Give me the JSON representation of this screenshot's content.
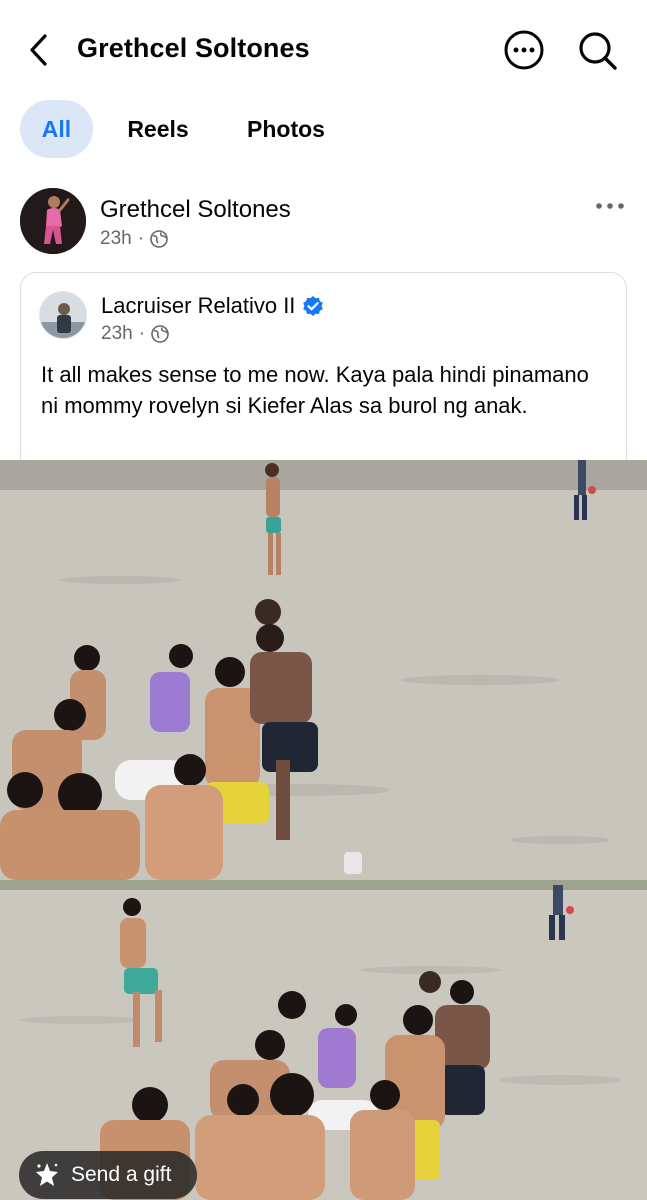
{
  "header": {
    "title": "Grethcel Soltones",
    "icons": {
      "back": "chevron-left-icon",
      "more": "more-circle-icon",
      "search": "search-icon"
    }
  },
  "tabs": [
    {
      "label": "All",
      "active": true
    },
    {
      "label": "Reels",
      "active": false
    },
    {
      "label": "Photos",
      "active": false
    }
  ],
  "post": {
    "author": "Grethcel Soltones",
    "time": "23h",
    "separator": "·",
    "audience_icon": "globe-icon",
    "more_icon": "horizontal-dots-icon",
    "shared": {
      "author": "Lacruiser Relativo II",
      "verified": true,
      "time": "23h",
      "separator": "·",
      "text": "It all makes sense to me now. Kaya pala hindi pinamano ni mommy rovelyn si Kiefer Alas sa burol ng anak."
    }
  },
  "footer": {
    "gift_label": "Send a gift",
    "gift_icon": "gift-star-icon"
  },
  "colors": {
    "accent": "#1877f2",
    "tab_active_bg": "#dbe7f7",
    "meta": "#65676b",
    "verified": "#1877f2"
  }
}
